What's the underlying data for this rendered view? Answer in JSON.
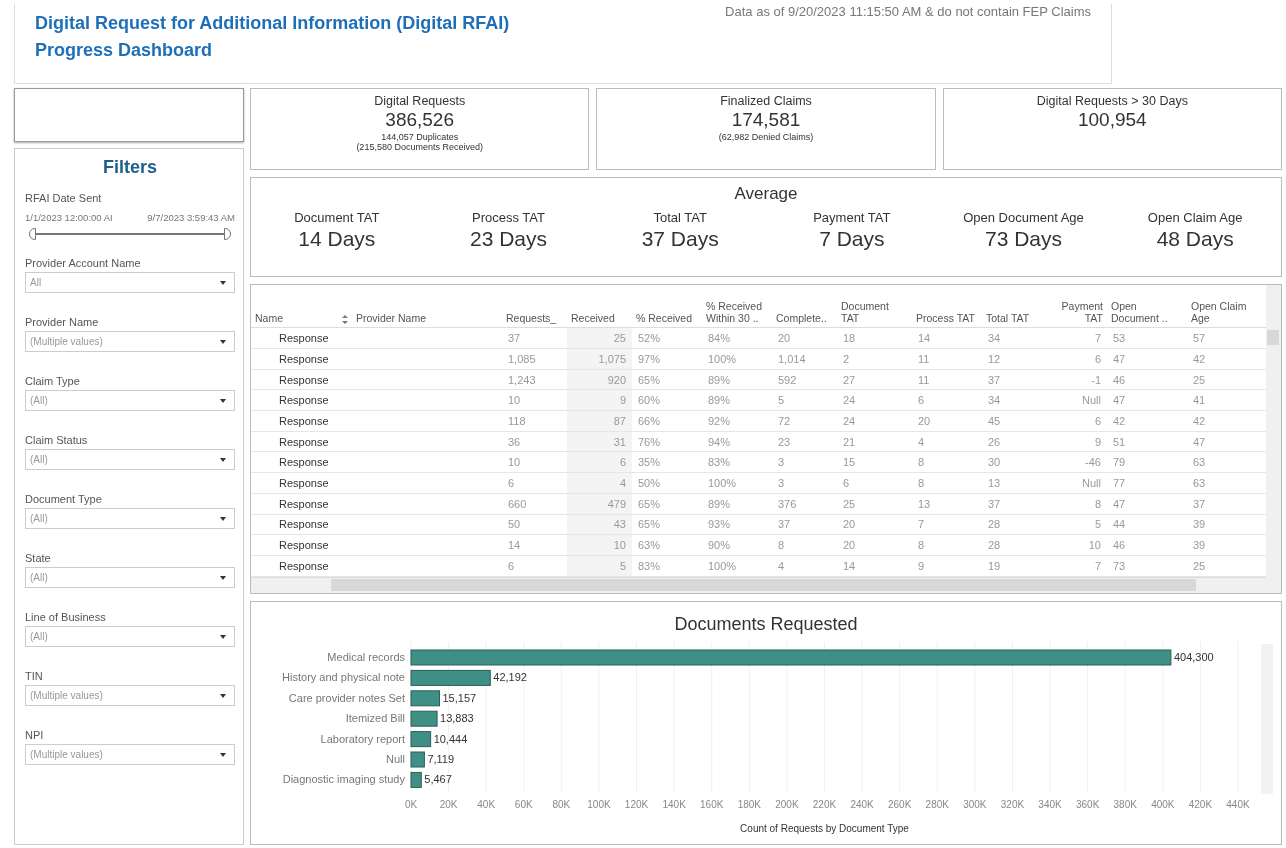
{
  "header": {
    "title": "Digital Request for Additional Information (Digital RFAI)",
    "subtitle": "Progress Dashboard",
    "data_note": "Data as of 9/20/2023 11:15:50 AM & do not contain FEP Claims"
  },
  "filters": {
    "title": "Filters",
    "date_range": {
      "label": "RFAI Date Sent",
      "start": "1/1/2023 12:00:00 AI",
      "end": "9/7/2023 3:59:43 AM",
      "level": 1
    },
    "dropdowns": [
      {
        "label": "Provider Account Name",
        "value": "All"
      },
      {
        "label": "Provider Name",
        "value": "(Multiple values)"
      },
      {
        "label": "Claim Type",
        "value": "(All)"
      },
      {
        "label": "Claim Status",
        "value": "(All)"
      },
      {
        "label": "Document Type",
        "value": "(All)"
      },
      {
        "label": "State",
        "value": "(All)"
      },
      {
        "label": "Line of Business",
        "value": "(All)"
      },
      {
        "label": "TIN",
        "value": "(Multiple values)"
      },
      {
        "label": "NPI",
        "value": "(Multiple values)"
      }
    ]
  },
  "kpis": [
    {
      "title": "Digital Requests",
      "value": "386,526",
      "notes": [
        "144,057 Duplicates",
        "(215,580 Documents Received)"
      ]
    },
    {
      "title": "Finalized Claims",
      "value": "174,581",
      "notes": [
        "(62,982 Denied Claims)"
      ]
    },
    {
      "title": "Digital Requests > 30 Days",
      "value": "100,954"
    }
  ],
  "average": {
    "title": "Average",
    "metrics": [
      {
        "label": "Document TAT",
        "value": "14 Days"
      },
      {
        "label": "Process TAT",
        "value": "23 Days"
      },
      {
        "label": "Total TAT",
        "value": "37 Days"
      },
      {
        "label": "Payment TAT",
        "value": "7 Days"
      },
      {
        "label": "Open Document Age",
        "value": "73 Days"
      },
      {
        "label": "Open Claim Age",
        "value": "48 Days"
      }
    ]
  },
  "table": {
    "columns": [
      "Name",
      "Provider Name",
      "Requests_",
      "Received",
      "% Received",
      "% Received Within 30 ..",
      "Complete..",
      "Document TAT",
      "Process TAT",
      "Total TAT",
      "Payment TAT",
      "Open Document ..",
      "Open Claim Age"
    ],
    "rows": [
      [
        "Response",
        "",
        "37",
        "25",
        "52%",
        "84%",
        "20",
        "18",
        "14",
        "34",
        "7",
        "53",
        "57"
      ],
      [
        "Response",
        "",
        "1,085",
        "1,075",
        "97%",
        "100%",
        "1,014",
        "2",
        "11",
        "12",
        "6",
        "47",
        "42"
      ],
      [
        "Response",
        "",
        "1,243",
        "920",
        "65%",
        "89%",
        "592",
        "27",
        "11",
        "37",
        "-1",
        "46",
        "25"
      ],
      [
        "Response",
        "",
        "10",
        "9",
        "60%",
        "89%",
        "5",
        "24",
        "6",
        "34",
        "Null",
        "47",
        "41"
      ],
      [
        "Response",
        "",
        "118",
        "87",
        "66%",
        "92%",
        "72",
        "24",
        "20",
        "45",
        "6",
        "42",
        "42"
      ],
      [
        "Response",
        "",
        "36",
        "31",
        "76%",
        "94%",
        "23",
        "21",
        "4",
        "26",
        "9",
        "51",
        "47"
      ],
      [
        "Response",
        "",
        "10",
        "6",
        "35%",
        "83%",
        "3",
        "15",
        "8",
        "30",
        "-46",
        "79",
        "63"
      ],
      [
        "Response",
        "",
        "6",
        "4",
        "50%",
        "100%",
        "3",
        "6",
        "8",
        "13",
        "Null",
        "77",
        "63"
      ],
      [
        "Response",
        "",
        "660",
        "479",
        "65%",
        "89%",
        "376",
        "25",
        "13",
        "37",
        "8",
        "47",
        "37"
      ],
      [
        "Response",
        "",
        "50",
        "43",
        "65%",
        "93%",
        "37",
        "20",
        "7",
        "28",
        "5",
        "44",
        "39"
      ],
      [
        "Response",
        "",
        "14",
        "10",
        "63%",
        "90%",
        "8",
        "20",
        "8",
        "28",
        "10",
        "46",
        "39"
      ],
      [
        "Response",
        "",
        "6",
        "5",
        "83%",
        "100%",
        "4",
        "14",
        "9",
        "19",
        "7",
        "73",
        "25"
      ]
    ]
  },
  "documents_chart": {
    "chart_data": {
      "type": "bar",
      "orientation": "horizontal",
      "title": "Documents Requested",
      "xlabel": "Count of Requests by Document Type",
      "categories": [
        "Medical records",
        "History and physical note",
        "Care provider notes Set",
        "Itemized Bill",
        "Laboratory report",
        "Null",
        "Diagnostic imaging study"
      ],
      "series": [
        {
          "color": "#3f8f87",
          "values": [
            404300,
            42192,
            15157,
            13883,
            10444,
            7119,
            5467
          ]
        }
      ],
      "value_labels": [
        "404,300",
        "42,192",
        "15,157",
        "13,883",
        "10,444",
        "7,119",
        "5,467"
      ],
      "grid": true,
      "xlim": [
        0,
        440000
      ],
      "xticks": [
        {
          "value": 0,
          "label": "0K"
        },
        {
          "value": 20000,
          "label": "20K"
        },
        {
          "value": 40000,
          "label": "40K"
        },
        {
          "value": 60000,
          "label": "60K"
        },
        {
          "value": 80000,
          "label": "80K"
        },
        {
          "value": 100000,
          "label": "100K"
        },
        {
          "value": 120000,
          "label": "120K"
        },
        {
          "value": 140000,
          "label": "140K"
        },
        {
          "value": 160000,
          "label": "160K"
        },
        {
          "value": 180000,
          "label": "180K"
        },
        {
          "value": 200000,
          "label": "200K"
        },
        {
          "value": 220000,
          "label": "220K"
        },
        {
          "value": 240000,
          "label": "240K"
        },
        {
          "value": 260000,
          "label": "260K"
        },
        {
          "value": 280000,
          "label": "280K"
        },
        {
          "value": 300000,
          "label": "300K"
        },
        {
          "value": 320000,
          "label": "320K"
        },
        {
          "value": 340000,
          "label": "340K"
        },
        {
          "value": 360000,
          "label": "360K"
        },
        {
          "value": 380000,
          "label": "380K"
        },
        {
          "value": 400000,
          "label": "400K"
        },
        {
          "value": 420000,
          "label": "420K"
        },
        {
          "value": 440000,
          "label": "440K"
        }
      ]
    }
  }
}
